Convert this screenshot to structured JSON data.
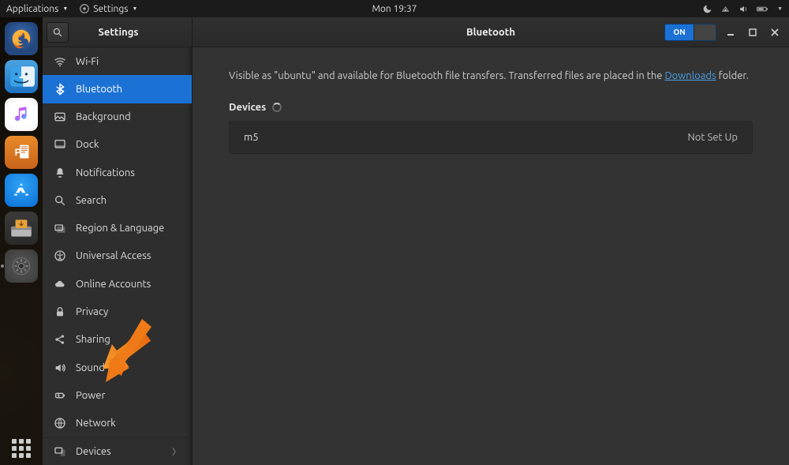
{
  "panel": {
    "applications": "Applications",
    "settings_menu": "Settings",
    "clock": "Mon 19:37"
  },
  "window": {
    "sidebar_title": "Settings",
    "title": "Bluetooth",
    "toggle_on_label": "ON"
  },
  "sidebar": {
    "items": [
      {
        "label": "Wi-Fi",
        "icon": "wifi"
      },
      {
        "label": "Bluetooth",
        "icon": "bluetooth",
        "selected": true
      },
      {
        "label": "Background",
        "icon": "background"
      },
      {
        "label": "Dock",
        "icon": "dock"
      },
      {
        "label": "Notifications",
        "icon": "bell"
      },
      {
        "label": "Search",
        "icon": "search"
      },
      {
        "label": "Region & Language",
        "icon": "globe"
      },
      {
        "label": "Universal Access",
        "icon": "access"
      },
      {
        "label": "Online Accounts",
        "icon": "cloud"
      },
      {
        "label": "Privacy",
        "icon": "lock"
      },
      {
        "label": "Sharing",
        "icon": "share"
      },
      {
        "label": "Sound",
        "icon": "sound"
      },
      {
        "label": "Power",
        "icon": "power"
      },
      {
        "label": "Network",
        "icon": "network"
      },
      {
        "label": "Devices",
        "icon": "devices",
        "has_chevron": true
      }
    ]
  },
  "content": {
    "desc_pre": "Visible as \"ubuntu\" and available for Bluetooth file transfers. Transferred files are placed in the ",
    "desc_link": "Downloads",
    "desc_post": " folder.",
    "devices_label": "Devices",
    "devices": [
      {
        "name": "m5",
        "status": "Not Set Up"
      }
    ]
  }
}
